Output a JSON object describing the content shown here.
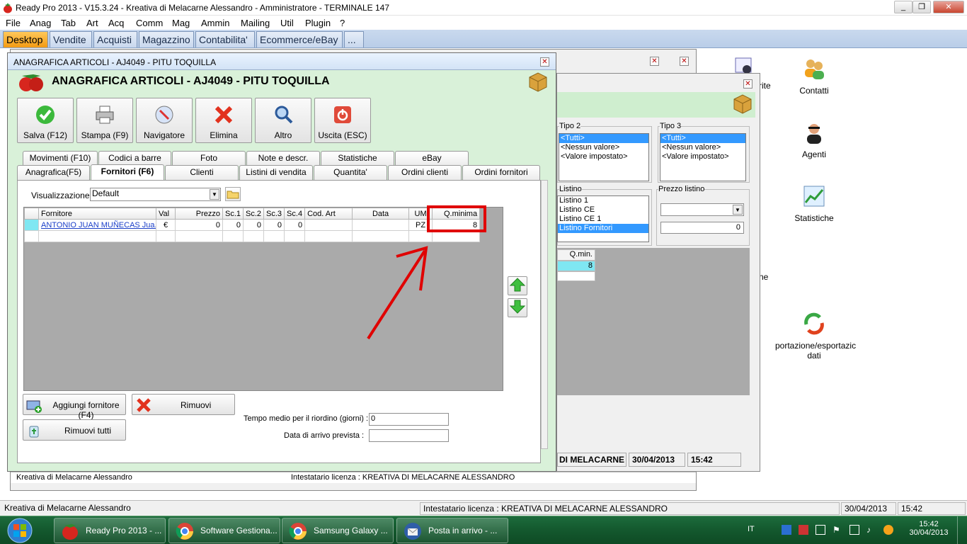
{
  "window": {
    "title": "Ready Pro 2013 - V15.3.24 - Kreativa di Melacarne Alessandro - Amministratore - TERMINALE 147",
    "controls": [
      "_",
      "❐",
      "✕"
    ]
  },
  "menu": [
    "File",
    "Anag",
    "Tab",
    "Art",
    "Acq",
    "Comm",
    "Mag",
    "Ammin",
    "Mailing",
    "Util",
    "Plugin",
    "?"
  ],
  "top_tabs": [
    "Desktop",
    "Vendite",
    "Acquisti",
    "Magazzino",
    "Contabilita'",
    "Ecommerce/eBay",
    "..."
  ],
  "desktop_icons": [
    {
      "label": "Contatti",
      "icon": "contacts-icon"
    },
    {
      "label": "Agenti",
      "icon": "agent-icon"
    },
    {
      "label": "Statistiche",
      "icon": "statistics-chart-icon"
    },
    {
      "label": "portazione/esportazic dati",
      "icon": "import-export-icon"
    }
  ],
  "desktop_partial_labels": [
    "rite",
    "ne"
  ],
  "bg_window": {
    "tipo2": {
      "label": "Tipo 2",
      "items": [
        "<Tutti>",
        "<Nessun valore>",
        "<Valore impostato>"
      ],
      "selected": 0
    },
    "tipo3": {
      "label": "Tipo 3",
      "items": [
        "<Tutti>",
        "<Nessun valore>",
        "<Valore impostato>"
      ],
      "selected": 0
    },
    "listino": {
      "label": "Listino",
      "items": [
        "Listino 1",
        "Listino CE",
        "Listino CE 1",
        "Listino Fornitori"
      ],
      "selected": 3
    },
    "prezzo_listino": {
      "label": "Prezzo listino",
      "value": "0"
    },
    "qmin_header": "Q.min.",
    "qmin_value": "8",
    "status_cells": [
      "DI MELACARNE ALE",
      "30/04/2013",
      "15:42"
    ]
  },
  "bg_window2_status": [
    "Kreativa di Melacarne Alessandro",
    "Intestatario licenza : KREATIVA DI MELACARNE ALESSANDRO",
    "30/04/2013",
    "15:42"
  ],
  "dialog": {
    "caption": "ANAGRAFICA ARTICOLI - AJ4049 - PITU TOQUILLA",
    "heading": "ANAGRAFICA ARTICOLI - AJ4049 - PITU TOQUILLA",
    "toolbar": [
      {
        "label": "Salva (F12)",
        "icon": "save-check-icon"
      },
      {
        "label": "Stampa (F9)",
        "icon": "printer-icon"
      },
      {
        "label": "Navigatore",
        "icon": "navigator-compass-icon"
      },
      {
        "label": "Elimina",
        "icon": "delete-x-icon"
      },
      {
        "label": "Altro",
        "icon": "magnifier-icon"
      },
      {
        "label": "Uscita (ESC)",
        "icon": "exit-power-icon"
      }
    ],
    "tabs_row1": [
      "Movimenti (F10)",
      "Codici a barre",
      "Foto",
      "Note e descr.",
      "Statistiche",
      "eBay"
    ],
    "tabs_row2": [
      "Anagrafica(F5)",
      "Fornitori (F6)",
      "Clienti",
      "Listini di vendita",
      "Quantita'",
      "Ordini clienti",
      "Ordini fornitori"
    ],
    "visualizzazione": {
      "label": "Visualizzazione :",
      "value": "Default"
    },
    "grid": {
      "headers": [
        "",
        "Fornitore",
        "Val",
        "Prezzo",
        "Sc.1",
        "Sc.2",
        "Sc.3",
        "Sc.4",
        "Cod. Art",
        "Data",
        "UM",
        "Q.minima"
      ],
      "rows": [
        [
          "",
          "ANTONIO JUAN MUÑECAS Jua...",
          "€",
          "0",
          "0",
          "0",
          "0",
          "0",
          "",
          "",
          "PZ",
          "8"
        ]
      ]
    },
    "buttons": {
      "add": "Aggiungi fornitore (F4)",
      "remove": "Rimuovi",
      "remove_all": "Rimuovi tutti"
    },
    "tempo": {
      "label": "Tempo medio per il riordino (giorni) :",
      "value": "0"
    },
    "arrivo": {
      "label": "Data di arrivo prevista :",
      "value": ""
    }
  },
  "status": [
    "Kreativa di Melacarne Alessandro",
    "Intestatario licenza : KREATIVA DI MELACARNE ALESSANDRO",
    "30/04/2013",
    "15:42"
  ],
  "taskbar": {
    "items": [
      {
        "label": "Ready Pro 2013 - ...",
        "icon": "strawberry-icon"
      },
      {
        "label": "Software Gestiona...",
        "icon": "chrome-icon"
      },
      {
        "label": "Samsung Galaxy ...",
        "icon": "chrome-icon"
      },
      {
        "label": "Posta in arrivo - ...",
        "icon": "thunderbird-icon"
      }
    ],
    "lang": "IT",
    "time": "15:42",
    "date": "30/04/2013"
  },
  "accent_colors": {
    "annotation_red": "#e00000",
    "selection_blue": "#3399ff",
    "dialog_green": "#d9f1d9",
    "desktop_tab": "#f39a12"
  }
}
